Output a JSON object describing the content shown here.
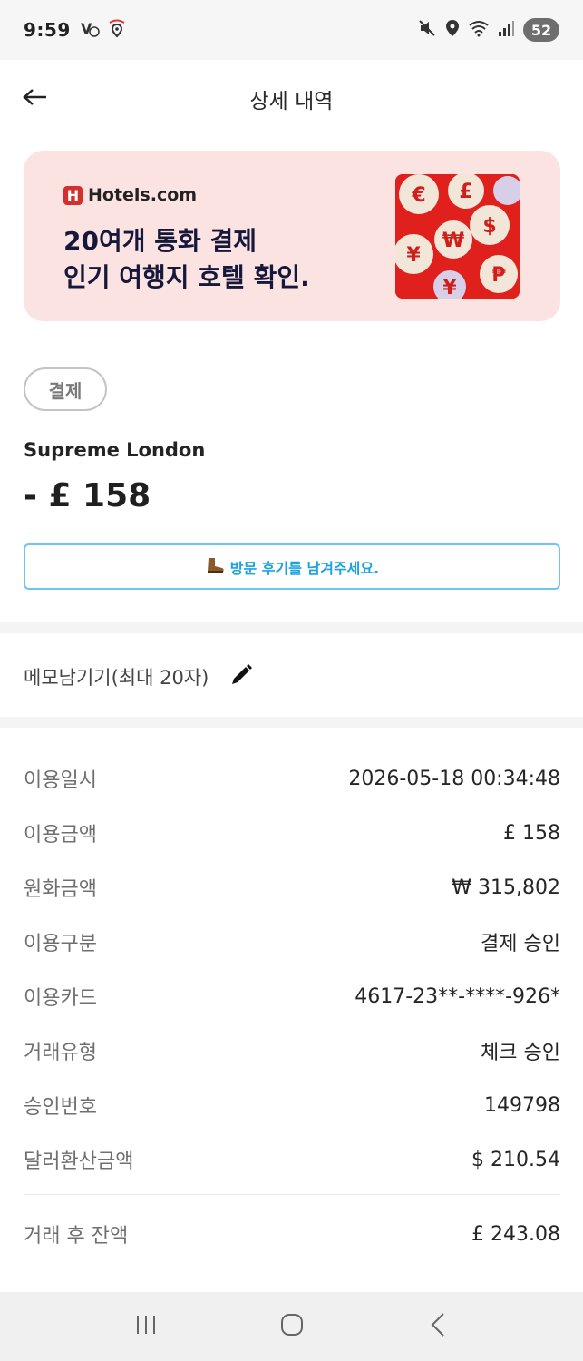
{
  "status_bar": {
    "time": "9:59",
    "battery": "52",
    "icons": [
      "notification-icon",
      "location-icon",
      "mute-icon",
      "location-pin-icon",
      "wifi-icon",
      "signal-icon"
    ]
  },
  "header": {
    "title": "상세 내역"
  },
  "banner": {
    "brand": "Hotels.com",
    "brand_logo_letter": "H",
    "line1": "20여개 통화 결제",
    "line2": "인기 여행지 호텔 확인."
  },
  "transaction": {
    "category": "결제",
    "merchant": "Supreme London",
    "amount": "- £ 158",
    "review_button": "방문 후기를 남겨주세요."
  },
  "memo": {
    "label": "메모남기기(최대 20자)"
  },
  "details": [
    {
      "label": "이용일시",
      "value": "2026-05-18 00:34:48"
    },
    {
      "label": "이용금액",
      "value": "£ 158"
    },
    {
      "label": "원화금액",
      "value": "₩ 315,802"
    },
    {
      "label": "이용구분",
      "value": "결제 승인"
    },
    {
      "label": "이용카드",
      "value": "4617-23**-****-926*"
    },
    {
      "label": "거래유형",
      "value": "체크 승인"
    },
    {
      "label": "승인번호",
      "value": "149798"
    },
    {
      "label": "달러환산금액",
      "value": "$ 210.54"
    }
  ],
  "balance": {
    "label": "거래 후 잔액",
    "value": "£ 243.08"
  },
  "colors": {
    "banner_bg": "#fbe3e1",
    "brand_red": "#d32f2f",
    "review_border": "#6cc6ee",
    "review_text": "#1aa3e0"
  }
}
